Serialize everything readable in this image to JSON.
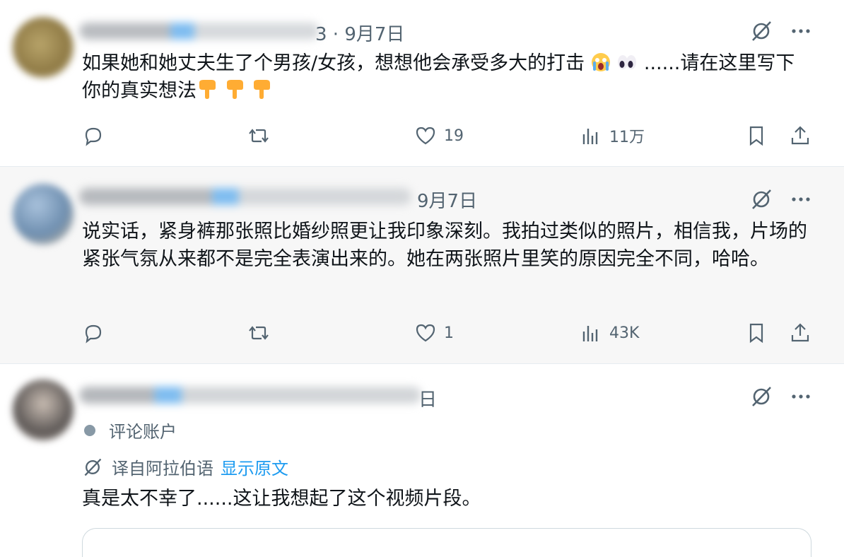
{
  "colors": {
    "accent": "#1d9bf0",
    "muted": "#536471",
    "text": "#0f1419"
  },
  "tweets": [
    {
      "date_suffix": "3 · 9月7日",
      "text": "如果她和她丈夫生了个男孩/女孩，想想他会承受多大的打击",
      "text_end": " ......请在这里写下你的真实想法",
      "emojis": [
        "crying-face-emoji",
        "eyes-emoji",
        "pointing-down-emoji",
        "pointing-down-emoji",
        "pointing-down-emoji"
      ],
      "likes": "19",
      "views": "11万"
    },
    {
      "date": "9月7日",
      "text": "说实话，紧身裤那张照比婚纱照更让我印象深刻。我拍过类似的照片，相信我，片场的紧张气氛从来都不是完全表演出来的。她在两张照片里笑的原因完全不同，哈哈。",
      "likes": "1",
      "views": "43K"
    },
    {
      "date_suffix": "日",
      "account_label": "评论账户",
      "translated_from": "译自阿拉伯语",
      "show_original": "显示原文",
      "text": "真是太不幸了......这让我想起了这个视频片段。"
    }
  ],
  "icons": {
    "reply": "reply-icon",
    "retweet": "retweet-icon",
    "like": "heart-icon",
    "views": "views-icon",
    "bookmark": "bookmark-icon",
    "share": "share-icon",
    "grok": "grok-icon",
    "more": "more-icon"
  }
}
